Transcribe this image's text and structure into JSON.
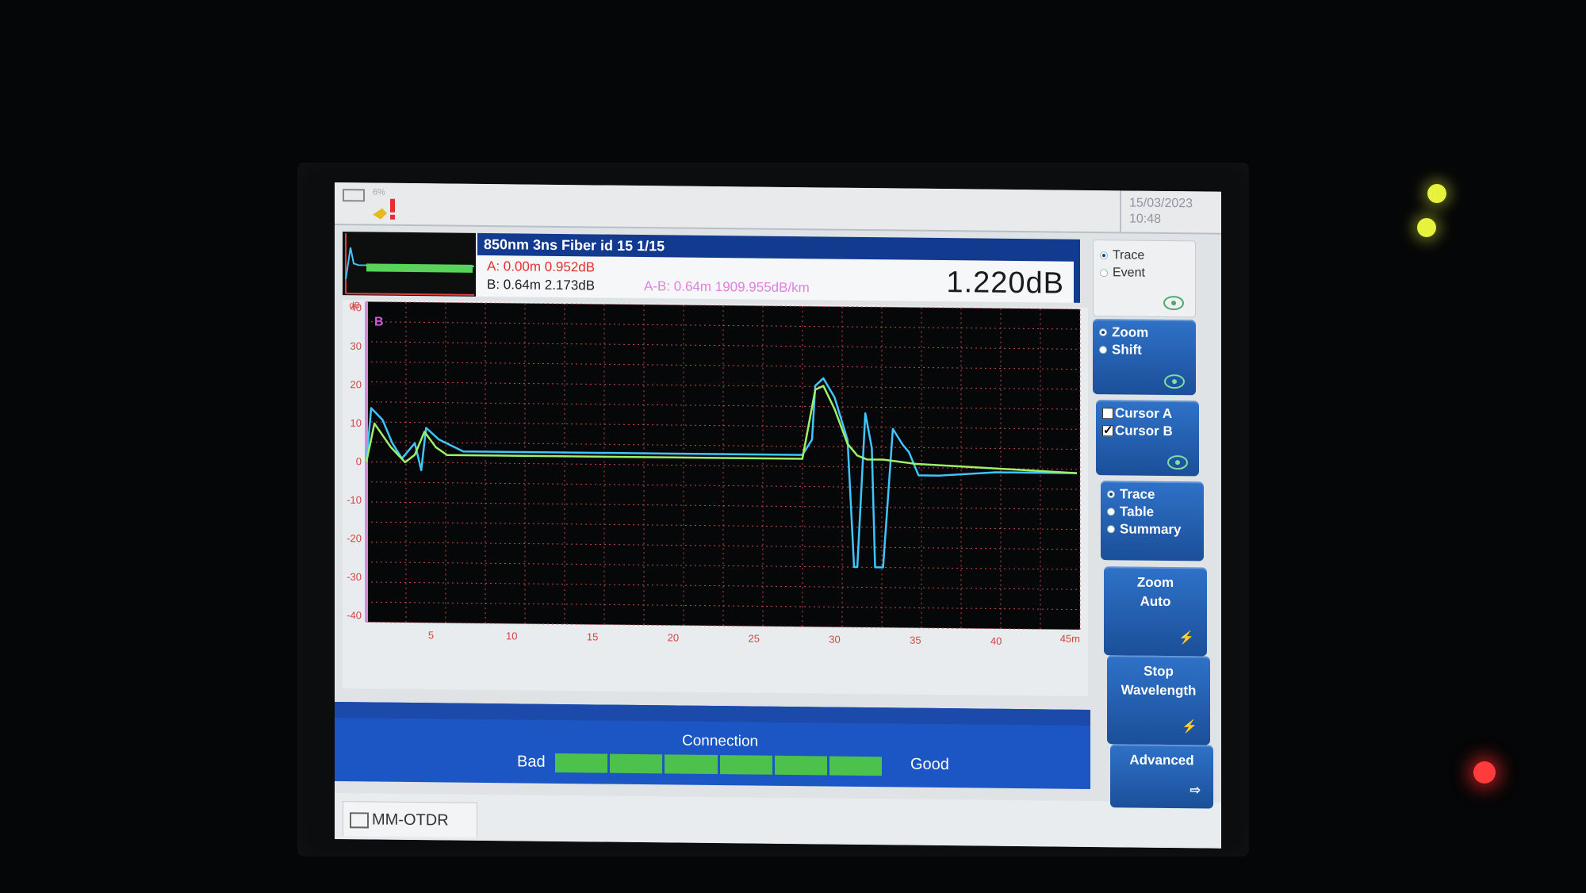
{
  "device": {
    "battery_pct": "6%",
    "datetime": {
      "date": "15/03/2023",
      "time": "10:48"
    }
  },
  "info": {
    "header": "850nm 3ns  Fiber id  15  1/15",
    "cursor_a": "A: 0.00m  0.952dB",
    "cursor_b": "B: 0.64m  2.173dB",
    "diff": "A-B: 0.64m 1909.955dB/km",
    "loss": "1.220dB"
  },
  "side_panel": {
    "view_mode": {
      "options": [
        "Trace",
        "Event"
      ],
      "selected": "Trace"
    },
    "zoom_shift": {
      "options": [
        "Zoom",
        "Shift"
      ],
      "selected": "Zoom"
    },
    "cursors": [
      {
        "label": "Cursor A",
        "checked": false
      },
      {
        "label": "Cursor B",
        "checked": true
      }
    ],
    "display": {
      "options": [
        "Trace",
        "Table",
        "Summary"
      ],
      "selected": "Trace"
    },
    "zoom_auto": {
      "line1": "Zoom",
      "line2": "Auto"
    },
    "stop_wavelength": {
      "line1": "Stop",
      "line2": "Wavelength"
    },
    "advanced": "Advanced"
  },
  "connection": {
    "title": "Connection",
    "bad": "Bad",
    "good": "Good",
    "level_pct": 92
  },
  "tab": {
    "label": "MM-OTDR"
  },
  "colors": {
    "trace_cyan": "#3fc6ff",
    "trace_green": "#9ef06a",
    "grid": "#c24a4a",
    "accent": "#123a8e"
  },
  "chart_data": {
    "type": "line",
    "xlabel": "",
    "ylabel": "dB",
    "x_unit_tick": "45m",
    "xlim": [
      1,
      45
    ],
    "ylim": [
      -40,
      40
    ],
    "x_ticks": [
      5,
      10,
      15,
      20,
      25,
      30,
      35,
      40
    ],
    "y_ticks": [
      40,
      30,
      20,
      10,
      0,
      -10,
      -20,
      -30,
      -40
    ],
    "cursor_label": "B",
    "series": [
      {
        "color": "#3fc6ff",
        "x": [
          1,
          1.3,
          2,
          2.6,
          3.2,
          4.0,
          4.4,
          4.7,
          5.5,
          7,
          10,
          20,
          28,
          28.6,
          28.8,
          29.3,
          30,
          30.8,
          31.2,
          31.4,
          31.9,
          32.3,
          32.5,
          33,
          33.6,
          34.2,
          34.6,
          35.2,
          36.5,
          40,
          45
        ],
        "y": [
          0,
          14,
          11,
          5,
          1,
          5,
          -2,
          9,
          6,
          3,
          3,
          3,
          3,
          7,
          21,
          23,
          18,
          7,
          -26,
          -26,
          14,
          5,
          -26,
          -26,
          10,
          6,
          4,
          -2,
          -2,
          -1,
          -1
        ]
      },
      {
        "color": "#9ef06a",
        "x": [
          1,
          1.5,
          2.5,
          3.4,
          4.0,
          4.6,
          5.3,
          6,
          10,
          20,
          28,
          28.8,
          29.3,
          30,
          30.8,
          31.4,
          32.0,
          33,
          35,
          40,
          45
        ],
        "y": [
          0,
          10,
          4,
          0,
          2,
          8,
          4,
          2,
          2,
          2,
          2,
          20,
          21,
          15,
          6,
          3,
          2,
          2,
          1,
          0,
          -1
        ]
      }
    ]
  }
}
